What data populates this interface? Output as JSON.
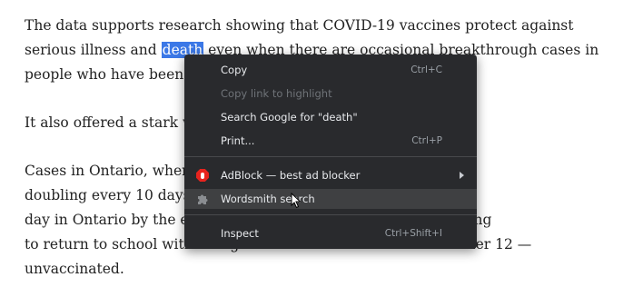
{
  "article": {
    "p1": [
      "The data supports research showing that COVID-19 vaccines protect against",
      "serious illness and ",
      "death",
      " even when there are occasional breakthrough cases in",
      "people who have been vaccinated."
    ],
    "p2": "It also offered a stark warning.",
    "p3": [
      "Cases in Ontario, where the seven-day average was 627, are",
      "doubling every 10 days, which could mean 1,000 cases a",
      "day in Ontario by the end of the month as teachers are preparing",
      "to return to school with a large cohort of students — those under 12 —",
      "unvaccinated."
    ]
  },
  "context_menu": {
    "copy": {
      "label": "Copy",
      "shortcut": "Ctrl+C"
    },
    "copy_link": {
      "label": "Copy link to highlight"
    },
    "search": {
      "label": "Search Google for \"death\""
    },
    "print": {
      "label": "Print...",
      "shortcut": "Ctrl+P"
    },
    "adblock": {
      "label": "AdBlock — best ad blocker",
      "icon": "adblock-icon"
    },
    "wordsmith": {
      "label": "Wordsmith search",
      "icon": "puzzle-icon"
    },
    "inspect": {
      "label": "Inspect",
      "shortcut": "Ctrl+Shift+I"
    }
  },
  "colors": {
    "menu_bg": "#292a2d",
    "selection": "#3b78e7",
    "adblock_red": "#e7231e"
  }
}
